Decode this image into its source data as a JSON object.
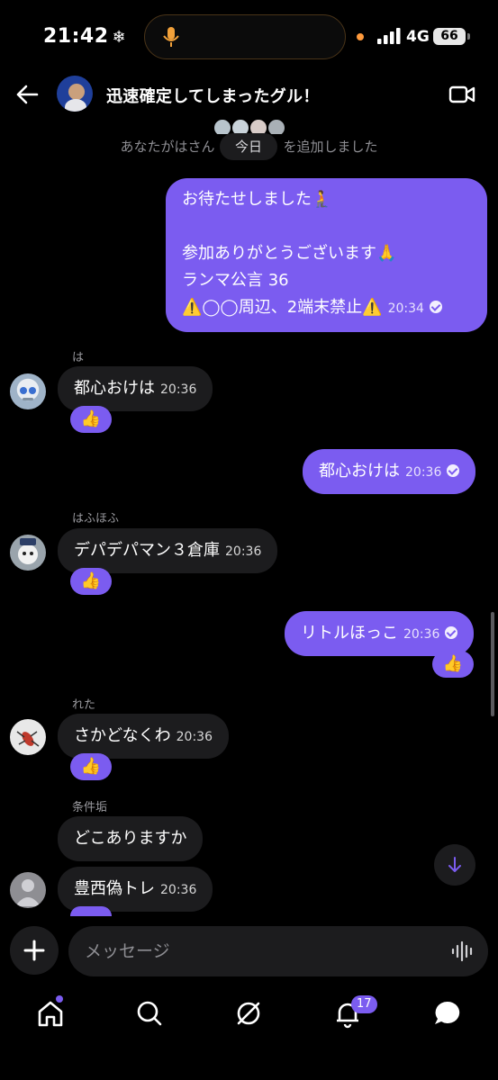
{
  "status_bar": {
    "time": "21:42",
    "network": "4G",
    "battery": "66"
  },
  "header": {
    "title": "迅速確定してしまったグル！"
  },
  "system": {
    "added_text": "あなたがはさん",
    "added_suffix": "を追加しました",
    "date": "今日"
  },
  "messages": [
    {
      "type": "out",
      "lines": [
        "お待たせしました🧎",
        "",
        "参加ありがとうございます🙏",
        "ランマ公言 36",
        "⚠️◯◯周辺、2端末禁止⚠️"
      ],
      "time": "20:34"
    },
    {
      "type": "in",
      "sender": "は",
      "text": "都心おけは",
      "time": "20:36",
      "reaction": "👍"
    },
    {
      "type": "out",
      "text": "都心おけは",
      "time": "20:36"
    },
    {
      "type": "in",
      "sender": "はふほふ",
      "text": "デパデパマン３倉庫",
      "time": "20:36",
      "reaction": "👍"
    },
    {
      "type": "out",
      "text": "リトルほっこ",
      "time": "20:36",
      "reaction": "👍"
    },
    {
      "type": "in",
      "sender": "れた",
      "text": "さかどなくわ",
      "time": "20:36",
      "reaction": "👍"
    },
    {
      "type": "in",
      "sender": "条件垢",
      "text": "どこありますか",
      "time": ""
    },
    {
      "type": "in",
      "sender": "",
      "text": "豊西偽トレ",
      "time": "20:36"
    }
  ],
  "composer": {
    "placeholder": "メッセージ"
  },
  "tabbar": {
    "notifications_badge": "17"
  },
  "colors": {
    "accent": "#7b5cf0",
    "incoming_bubble": "#1c1c1e",
    "background": "#000000"
  }
}
